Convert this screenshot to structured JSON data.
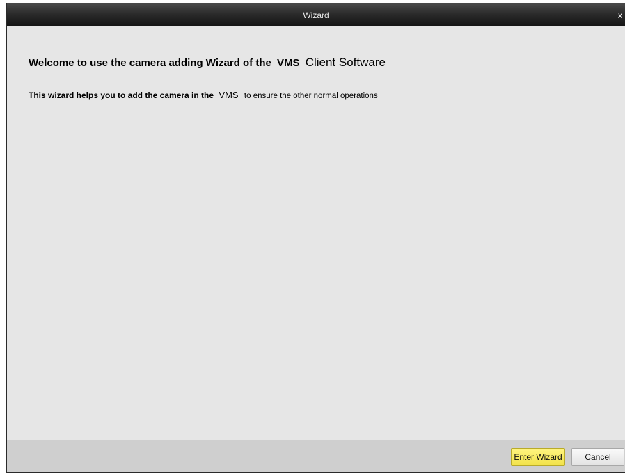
{
  "window": {
    "title": "Wizard",
    "close_label": "x"
  },
  "content": {
    "heading_prefix": "Welcome to use the camera adding Wizard of the",
    "heading_vms": "VMS",
    "heading_product": "Client Software",
    "description_prefix": "This wizard helps you to add the camera in the",
    "description_vms": "VMS",
    "description_suffix": "to ensure the other normal operations"
  },
  "footer": {
    "enter_label": "Enter Wizard",
    "cancel_label": "Cancel"
  },
  "colors": {
    "titlebar": "#1e1e1e",
    "content_bg": "#e6e6e6",
    "footer_bg": "#cfcfcf",
    "primary_button": "#f6e85a"
  }
}
